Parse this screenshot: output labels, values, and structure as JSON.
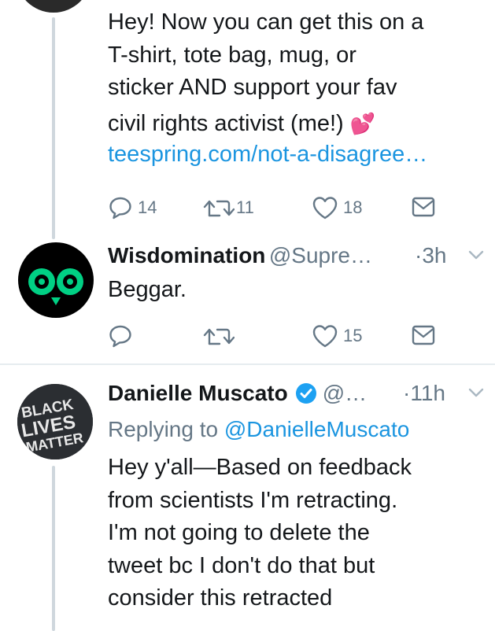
{
  "tweets": [
    {
      "text_lines": [
        "Hey! Now you can get this on a",
        "T-shirt, tote bag, mug, or",
        "sticker AND support your fav",
        "civil rights activist (me!)"
      ],
      "emoji": "💕",
      "link": "teespring.com/not-a-disagree…",
      "actions": {
        "reply": "14",
        "retweet": "11",
        "like": "18"
      }
    },
    {
      "name": "Wisdomination",
      "handle": "@Supre…",
      "time": "·3h",
      "text": "Beggar.",
      "actions": {
        "reply": "",
        "retweet": "",
        "like": "15"
      }
    },
    {
      "name": "Danielle Muscato",
      "handle": "@…",
      "time": "·11h",
      "replying_prefix": "Replying to ",
      "replying_to": "@DanielleMuscato",
      "text_lines": [
        "Hey y'all—Based on feedback",
        "from scientists I'm retracting.",
        "I'm not going to delete the",
        "tweet bc I don't do that but",
        "consider this retracted"
      ]
    }
  ],
  "avatar3": {
    "line1": "BLACK",
    "line2": "LIVES",
    "line3": "MATTER"
  },
  "colors": {
    "link": "#1b95e0",
    "grey": "#657786",
    "verified": "#1da1f2",
    "owl_green": "#00d084"
  }
}
